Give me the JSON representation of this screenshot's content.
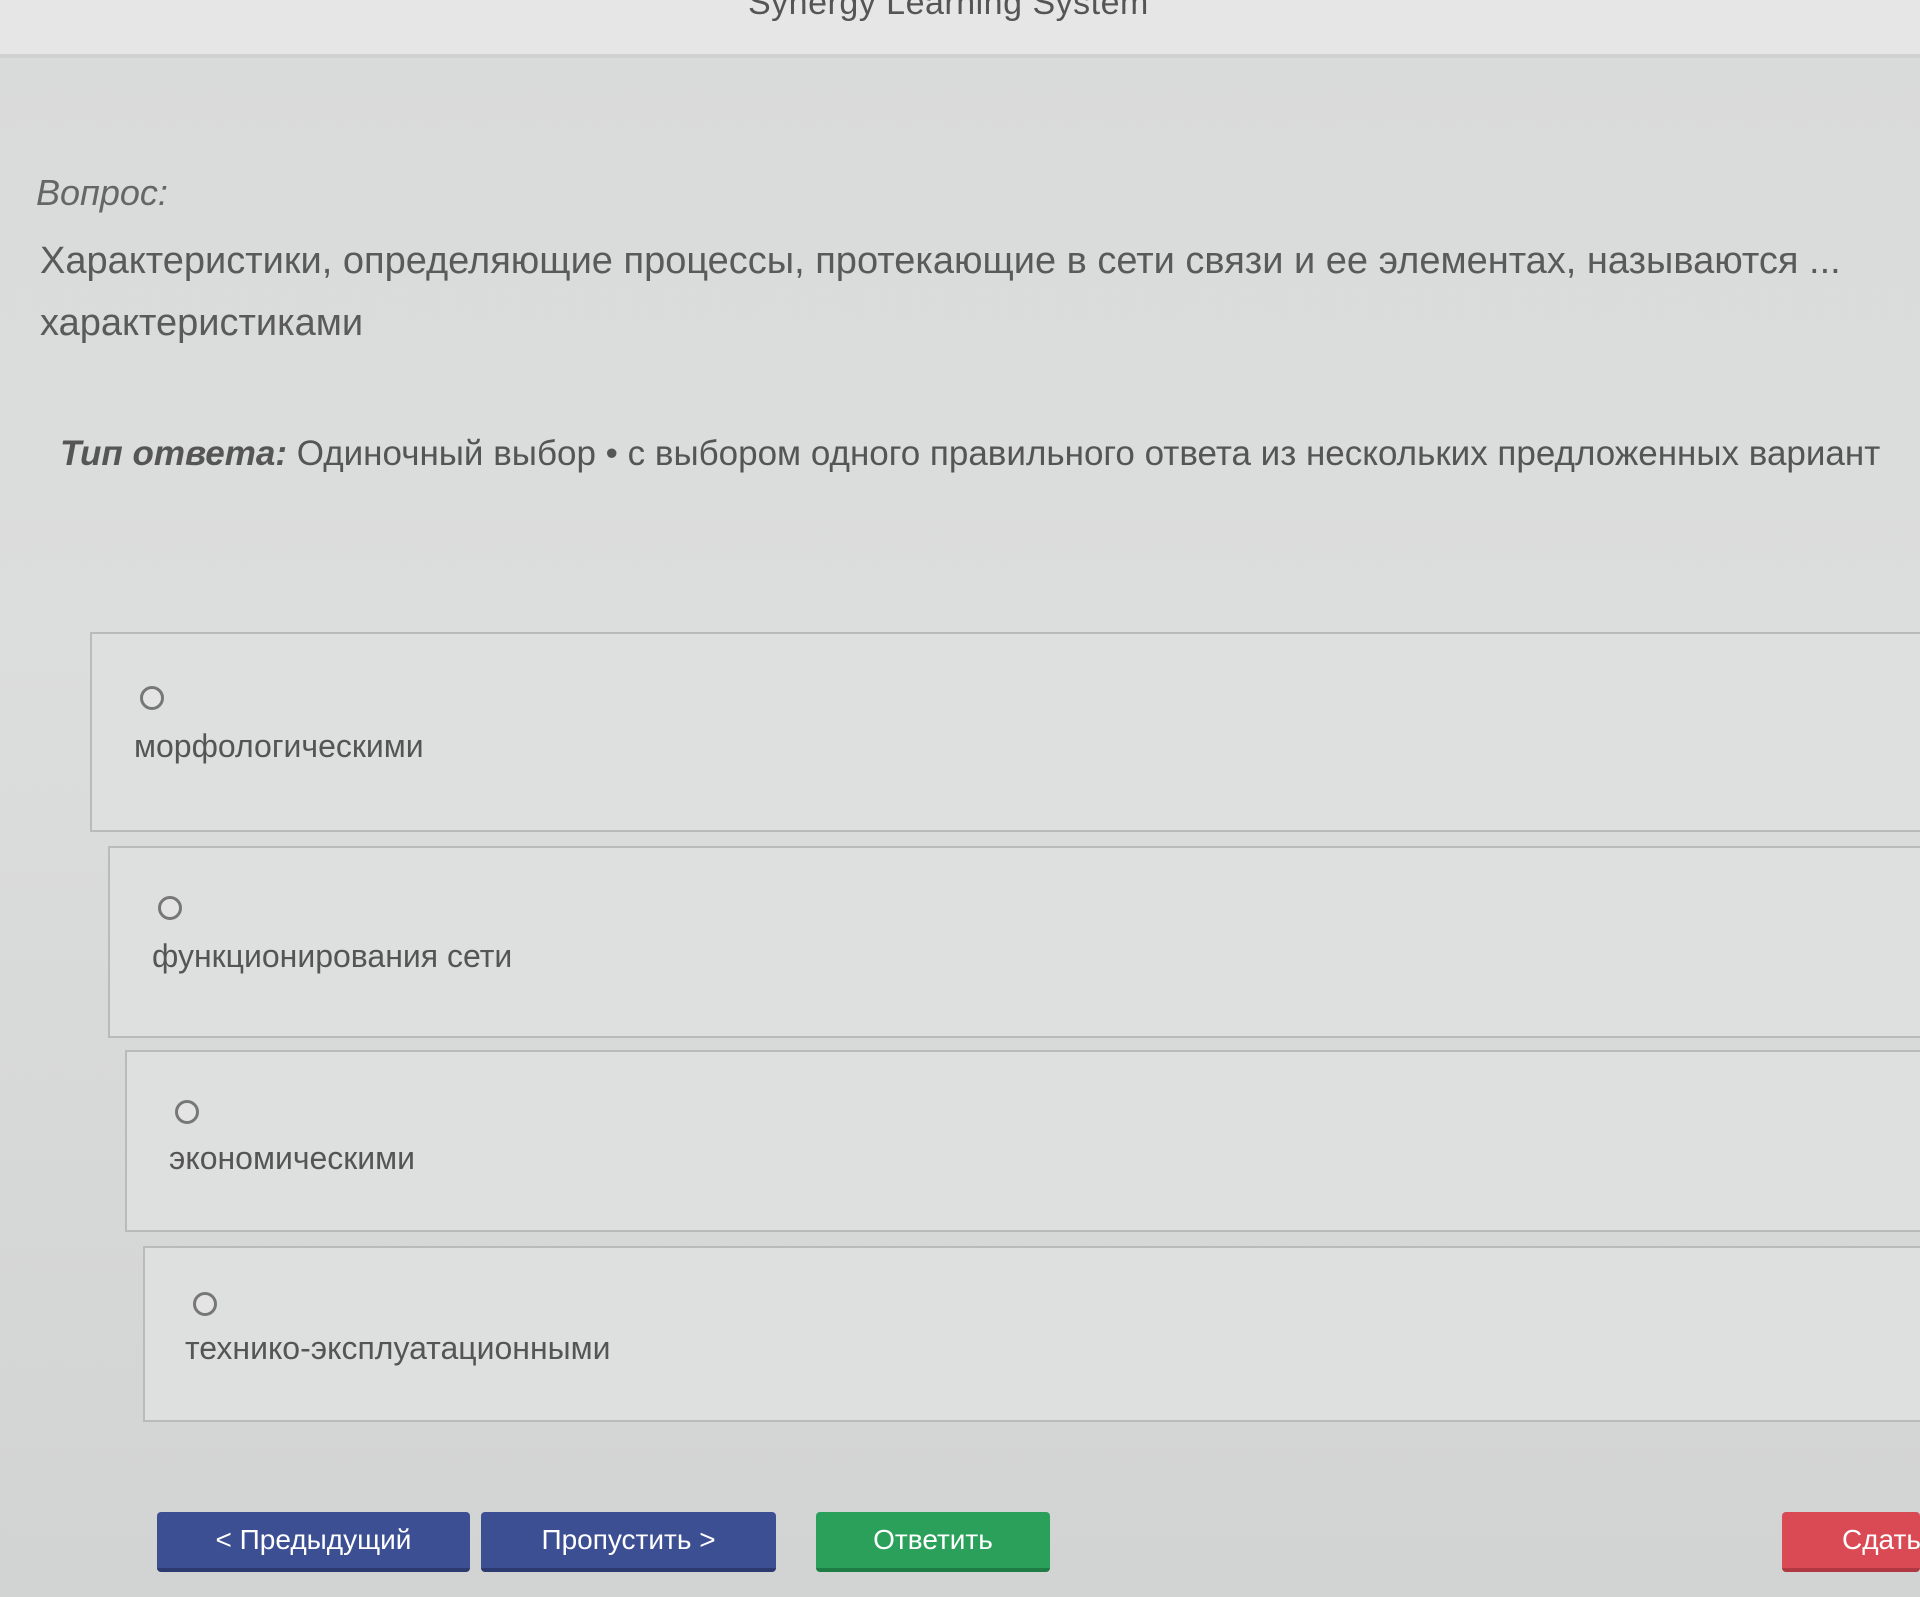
{
  "header": {
    "app_title": "Synergy Learning System"
  },
  "question": {
    "label": "Вопрос:",
    "text": "Характеристики, определяющие процессы, протекающие в сети связи и ее элементах, называются ... характеристиками"
  },
  "answer_type": {
    "label": "Тип ответа:",
    "value": "Одиночный выбор • с выбором одного правильного ответа из нескольких предложенных вариант"
  },
  "options": [
    {
      "label": "морфологическими",
      "selected": false
    },
    {
      "label": "функционирования сети",
      "selected": false
    },
    {
      "label": "экономическими",
      "selected": false
    },
    {
      "label": "технико-эксплуатационными",
      "selected": false
    }
  ],
  "buttons": {
    "prev": "< Предыдущий",
    "skip": "Пропустить >",
    "answer": "Ответить",
    "submit": "Сдать"
  },
  "colors": {
    "primary_blue": "#3d4f93",
    "success_green": "#2aa05a",
    "danger_red": "#d94a55"
  }
}
